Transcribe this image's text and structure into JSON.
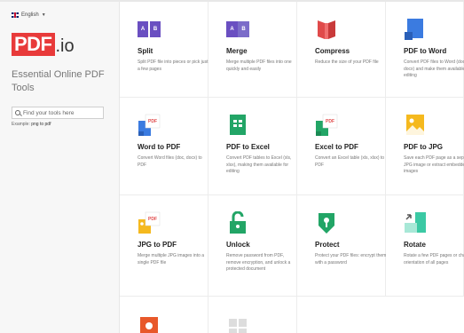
{
  "language": "English",
  "logo": {
    "box": "PDF",
    "suffix": ".io"
  },
  "tagline": "Essential Online PDF Tools",
  "search": {
    "placeholder": "Find your tools here",
    "example_label": "Example:",
    "example_value": "png to pdf"
  },
  "icons": {
    "split": {
      "left": "A",
      "right": "B"
    },
    "merge": {
      "left": "A",
      "right": "B"
    },
    "pdf_badge": "PDF"
  },
  "colors": {
    "brand_red": "#e83a3a",
    "purple": "#6a4fc1",
    "red": "#e04a4a",
    "blue": "#3b7be0",
    "green": "#22a566",
    "yellow": "#f5b91e",
    "teal": "#3bc9a4"
  },
  "tools": [
    {
      "name": "Split",
      "desc": "Split PDF file into pieces or pick just a few pages",
      "icon": "split-icon"
    },
    {
      "name": "Merge",
      "desc": "Merge multiple PDF files into one quickly and easily",
      "icon": "merge-icon"
    },
    {
      "name": "Compress",
      "desc": "Reduce the size of your PDF file",
      "icon": "compress-icon"
    },
    {
      "name": "PDF to Word",
      "desc": "Convert PDF files to Word (doc, docx) and make them available for editing",
      "icon": "pdf-to-word-icon"
    },
    {
      "name": "Word to PDF",
      "desc": "Convert Word files (doc, docx) to PDF",
      "icon": "word-to-pdf-icon"
    },
    {
      "name": "PDF to Excel",
      "desc": "Convert PDF tables to Excel (xls, xlsx), making them available for editing",
      "icon": "pdf-to-excel-icon"
    },
    {
      "name": "Excel to PDF",
      "desc": "Convert an Excel table (xls, xlsx) to PDF",
      "icon": "excel-to-pdf-icon"
    },
    {
      "name": "PDF to JPG",
      "desc": "Save each PDF page as a separate JPG image or extract embedded images",
      "icon": "pdf-to-jpg-icon"
    },
    {
      "name": "JPG to PDF",
      "desc": "Merge multiple JPG images into a single PDF file",
      "icon": "jpg-to-pdf-icon"
    },
    {
      "name": "Unlock",
      "desc": "Remove password from PDF, remove encryption, and unlock a protected document",
      "icon": "unlock-icon"
    },
    {
      "name": "Protect",
      "desc": "Protect your PDF files: encrypt them with a password",
      "icon": "protect-icon"
    },
    {
      "name": "Rotate",
      "desc": "Rotate a few PDF pages or change orientation of all pages",
      "icon": "rotate-icon"
    }
  ]
}
